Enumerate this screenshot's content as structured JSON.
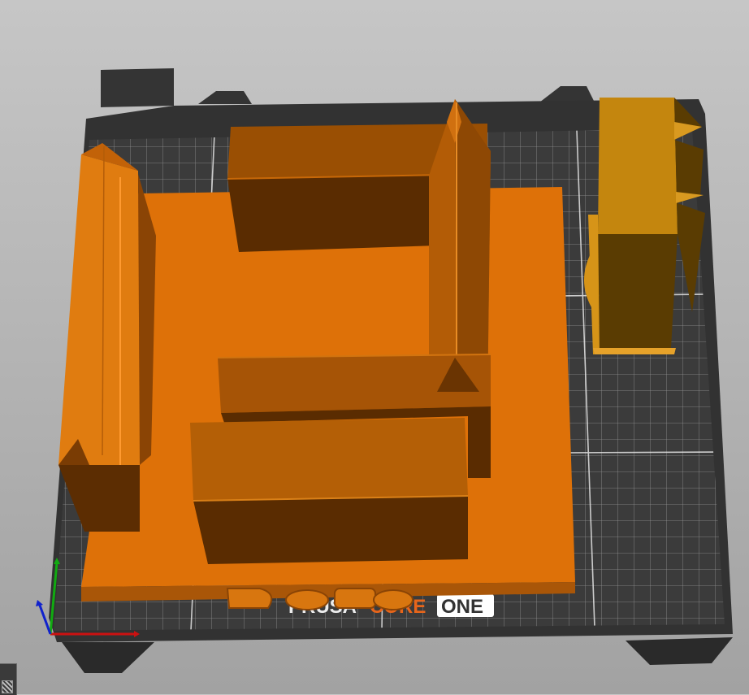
{
  "printer": {
    "brand": "PRUSA",
    "model": "CORE",
    "variant": "ONE"
  },
  "colors": {
    "bed": "#2f2f2f",
    "grid": "#e8e8e8",
    "model_light": "#e07c10",
    "model_mid": "#a95608",
    "model_dark": "#5c2d02",
    "selected_model": "#c78c12",
    "brand_accent": "#e8651a"
  },
  "icons": {
    "axes": "xyz-axes-icon",
    "corner": "view-toggle-icon"
  }
}
